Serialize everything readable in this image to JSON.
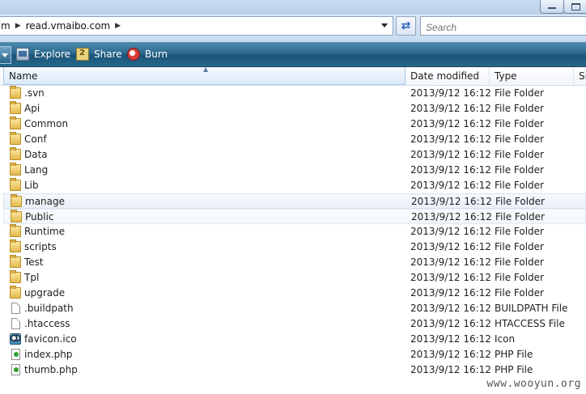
{
  "address": {
    "crumbs": [
      "m",
      "read.vmaibo.com"
    ]
  },
  "search": {
    "placeholder": "Search"
  },
  "toolbar": {
    "explore_label": "Explore",
    "share_label": "Share",
    "burn_label": "Burn"
  },
  "columns": {
    "name": "Name",
    "date": "Date modified",
    "type": "Type",
    "size": "Si"
  },
  "files": [
    {
      "name": ".svn",
      "date": "2013/9/12 16:12",
      "type": "File Folder",
      "icon": "folder-icon"
    },
    {
      "name": "Api",
      "date": "2013/9/12 16:12",
      "type": "File Folder",
      "icon": "folder-icon"
    },
    {
      "name": "Common",
      "date": "2013/9/12 16:12",
      "type": "File Folder",
      "icon": "folder-icon"
    },
    {
      "name": "Conf",
      "date": "2013/9/12 16:12",
      "type": "File Folder",
      "icon": "folder-icon"
    },
    {
      "name": "Data",
      "date": "2013/9/12 16:12",
      "type": "File Folder",
      "icon": "folder-icon"
    },
    {
      "name": "Lang",
      "date": "2013/9/12 16:12",
      "type": "File Folder",
      "icon": "folder-icon"
    },
    {
      "name": "Lib",
      "date": "2013/9/12 16:12",
      "type": "File Folder",
      "icon": "folder-icon"
    },
    {
      "name": "manage",
      "date": "2013/9/12 16:12",
      "type": "File Folder",
      "icon": "folder-icon"
    },
    {
      "name": "Public",
      "date": "2013/9/12 16:12",
      "type": "File Folder",
      "icon": "folder-icon"
    },
    {
      "name": "Runtime",
      "date": "2013/9/12 16:12",
      "type": "File Folder",
      "icon": "folder-icon"
    },
    {
      "name": "scripts",
      "date": "2013/9/12 16:12",
      "type": "File Folder",
      "icon": "folder-icon"
    },
    {
      "name": "Test",
      "date": "2013/9/12 16:12",
      "type": "File Folder",
      "icon": "folder-icon"
    },
    {
      "name": "Tpl",
      "date": "2013/9/12 16:12",
      "type": "File Folder",
      "icon": "folder-icon"
    },
    {
      "name": "upgrade",
      "date": "2013/9/12 16:12",
      "type": "File Folder",
      "icon": "folder-icon"
    },
    {
      "name": ".buildpath",
      "date": "2013/9/12 16:12",
      "type": "BUILDPATH File",
      "icon": "file-icon"
    },
    {
      "name": ".htaccess",
      "date": "2013/9/12 16:12",
      "type": "HTACCESS File",
      "icon": "file-icon"
    },
    {
      "name": "favicon.ico",
      "date": "2013/9/12 16:12",
      "type": "Icon",
      "icon": "ico-icon"
    },
    {
      "name": "index.php",
      "date": "2013/9/12 16:12",
      "type": "PHP File",
      "icon": "php-file-icon"
    },
    {
      "name": "thumb.php",
      "date": "2013/9/12 16:12",
      "type": "PHP File",
      "icon": "php-file-icon"
    }
  ],
  "watermark": "www.wooyun.org"
}
